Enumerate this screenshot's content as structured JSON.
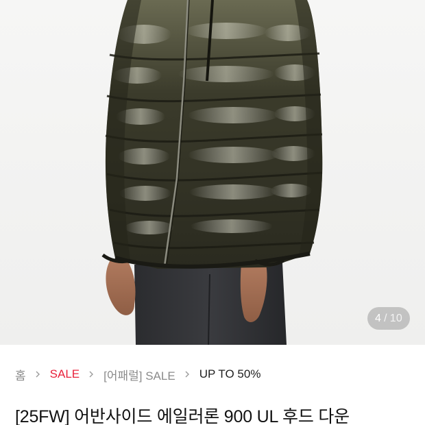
{
  "gallery": {
    "image_alt": "down-jacket-photo",
    "counter_current": "4",
    "counter_separator": "/",
    "counter_total": "10"
  },
  "breadcrumb": {
    "items": [
      {
        "label": "홈"
      },
      {
        "label": "SALE"
      },
      {
        "label": "[어패럴] SALE"
      },
      {
        "label": "UP TO 50%"
      }
    ]
  },
  "product": {
    "title": "[25FW] 어반사이드 에일러론 900 UL 후드 다운"
  },
  "colors": {
    "sale_red": "#e8213b",
    "jacket": "#3a3a2a",
    "background": "#f4f4f3"
  }
}
